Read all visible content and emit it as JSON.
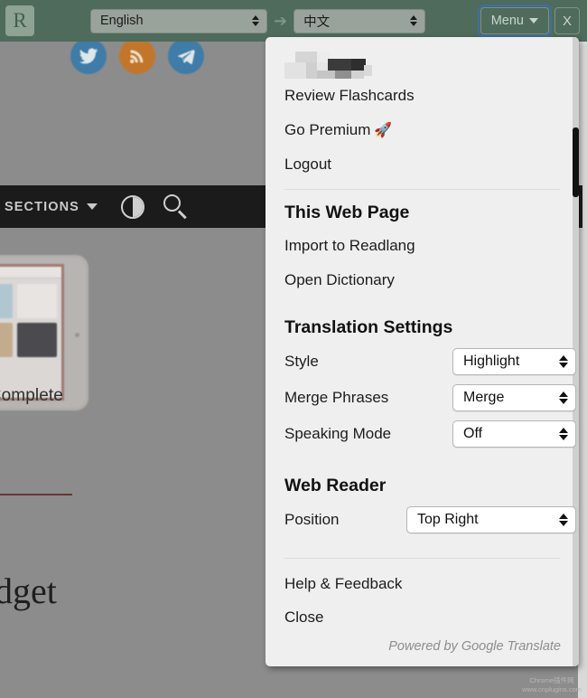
{
  "toolbar": {
    "logo_letter": "R",
    "source_language": "English",
    "target_language": "中文",
    "arrow_glyph": "➔",
    "menu_label": "Menu",
    "close_label": "X"
  },
  "background_page": {
    "nav": {
      "sections_label": "SECTIONS",
      "contrast_icon": "contrast-icon",
      "search_icon": "search-icon"
    },
    "social_icons": [
      "twitter-icon",
      "rss-icon",
      "telegram-icon"
    ],
    "article": {
      "image_caption": "r Complete",
      "headline_fragment": "dget"
    }
  },
  "menu_panel": {
    "account_name_redacted": "",
    "account": [
      {
        "label": "Review Flashcards",
        "name": "review-flashcards"
      },
      {
        "label": "Go Premium",
        "name": "go-premium",
        "icon": "🚀"
      },
      {
        "label": "Logout",
        "name": "logout"
      }
    ],
    "web_page_section": {
      "title": "This Web Page",
      "items": [
        {
          "label": "Import to Readlang",
          "name": "import-to-readlang"
        },
        {
          "label": "Open Dictionary",
          "name": "open-dictionary"
        }
      ]
    },
    "translation_settings": {
      "title": "Translation Settings",
      "rows": [
        {
          "label": "Style",
          "value": "Highlight",
          "name": "style"
        },
        {
          "label": "Merge Phrases",
          "value": "Merge",
          "name": "merge-phrases"
        },
        {
          "label": "Speaking Mode",
          "value": "Off",
          "name": "speaking-mode"
        }
      ]
    },
    "web_reader": {
      "title": "Web Reader",
      "rows": [
        {
          "label": "Position",
          "value": "Top Right",
          "name": "position"
        }
      ]
    },
    "footer_items": [
      {
        "label": "Help & Feedback",
        "name": "help-and-feedback"
      },
      {
        "label": "Close",
        "name": "close"
      }
    ],
    "powered_by": "Powered by Google Translate"
  },
  "watermark": {
    "line1": "Chrome插件网",
    "line2": "www.cnplugins.com"
  }
}
